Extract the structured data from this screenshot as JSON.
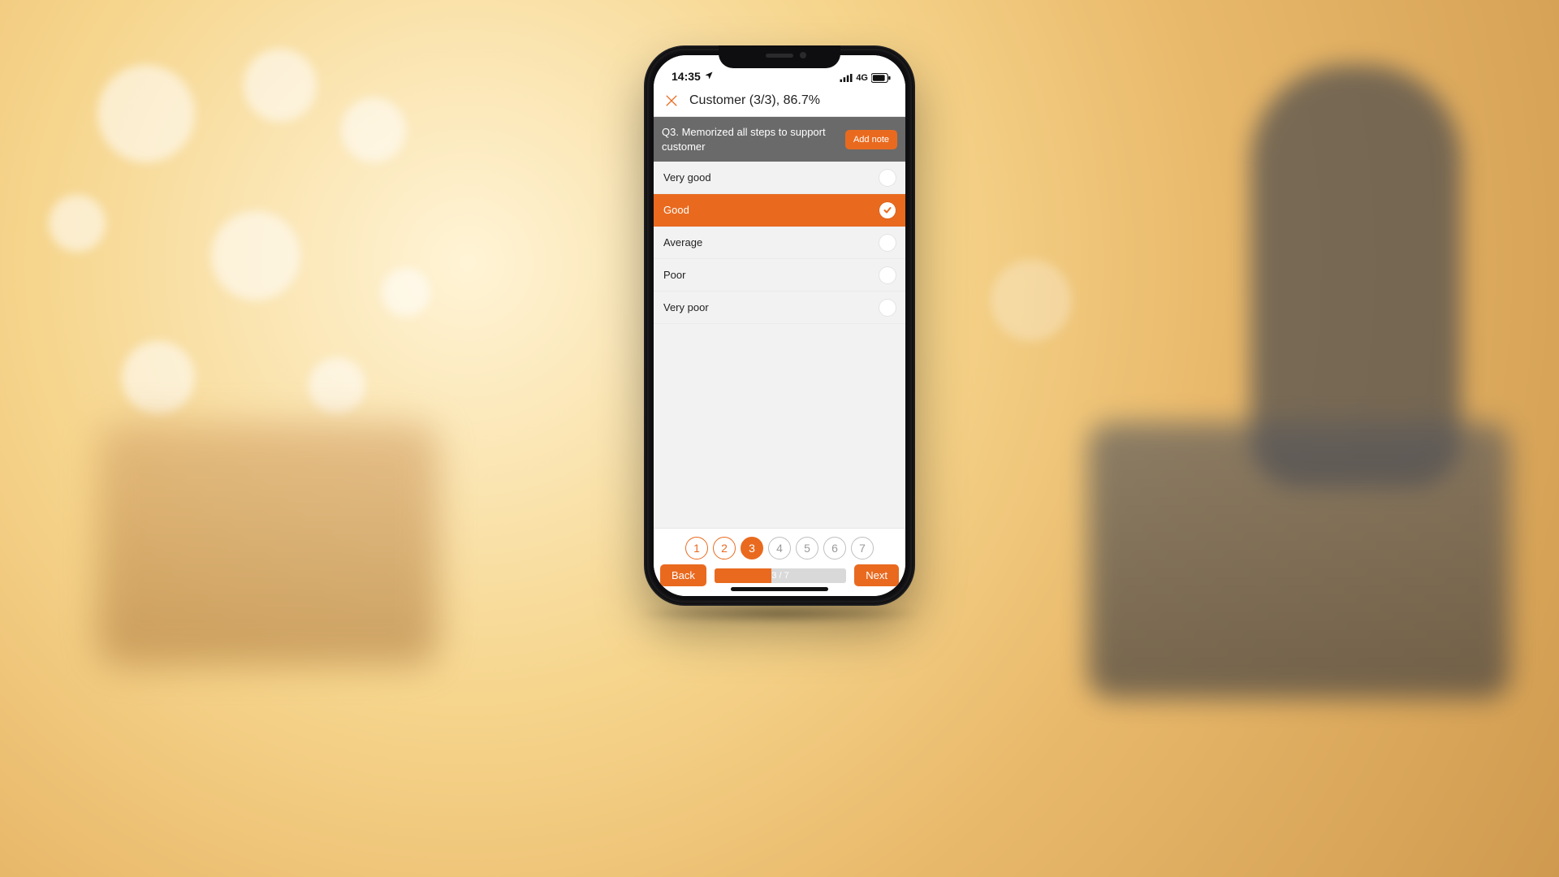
{
  "status": {
    "time": "14:35",
    "network_label": "4G"
  },
  "header": {
    "title": "Customer (3/3), 86.7%"
  },
  "question": {
    "text": "Q3. Memorized all steps to support customer",
    "add_note_label": "Add note"
  },
  "options": [
    {
      "label": "Very good",
      "selected": false
    },
    {
      "label": "Good",
      "selected": true
    },
    {
      "label": "Average",
      "selected": false
    },
    {
      "label": "Poor",
      "selected": false
    },
    {
      "label": "Very poor",
      "selected": false
    }
  ],
  "pager": {
    "pages": [
      {
        "n": "1",
        "state": "done"
      },
      {
        "n": "2",
        "state": "done"
      },
      {
        "n": "3",
        "state": "current"
      },
      {
        "n": "4",
        "state": "future"
      },
      {
        "n": "5",
        "state": "future"
      },
      {
        "n": "6",
        "state": "future"
      },
      {
        "n": "7",
        "state": "future"
      }
    ],
    "back_label": "Back",
    "next_label": "Next",
    "progress_label": "3 / 7",
    "progress_pct": 43
  },
  "colors": {
    "accent": "#e96a1f"
  }
}
